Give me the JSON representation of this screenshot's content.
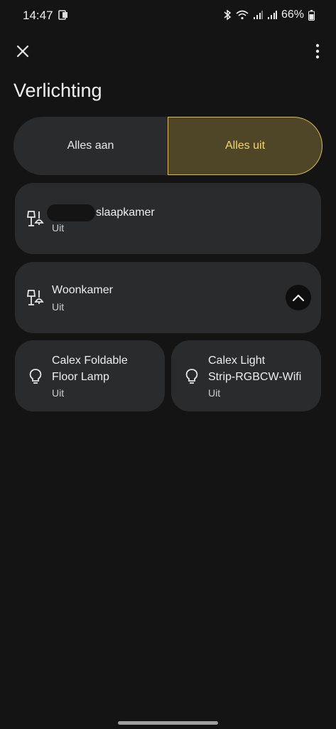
{
  "status_bar": {
    "time": "14:47",
    "battery": "66%",
    "icons": [
      "notification-icon",
      "bluetooth-icon",
      "wifi-icon",
      "signal-icon",
      "signal-icon",
      "battery-icon"
    ]
  },
  "header": {
    "title": "Verlichting"
  },
  "toggle": {
    "on_label": "Alles aan",
    "off_label": "Alles uit"
  },
  "groups": [
    {
      "name": "slaapkamer",
      "status": "Uit",
      "icon": "lamp-group-icon"
    },
    {
      "name": "Woonkamer",
      "status": "Uit",
      "icon": "lamp-group-icon",
      "expand_icon": "chevron-up-icon"
    }
  ],
  "devices": [
    {
      "name_line1": "Calex Foldable",
      "name_line2": "Floor Lamp",
      "status": "Uit",
      "icon": "bulb-icon"
    },
    {
      "name_line1": "Calex Light",
      "name_line2": "Strip-RGBCW-Wifi",
      "status": "Uit",
      "icon": "bulb-icon"
    }
  ],
  "colors": {
    "background": "#141414",
    "card": "#2a2b2d",
    "accent_fill": "#4f4628",
    "accent_text": "#f5d66b"
  }
}
